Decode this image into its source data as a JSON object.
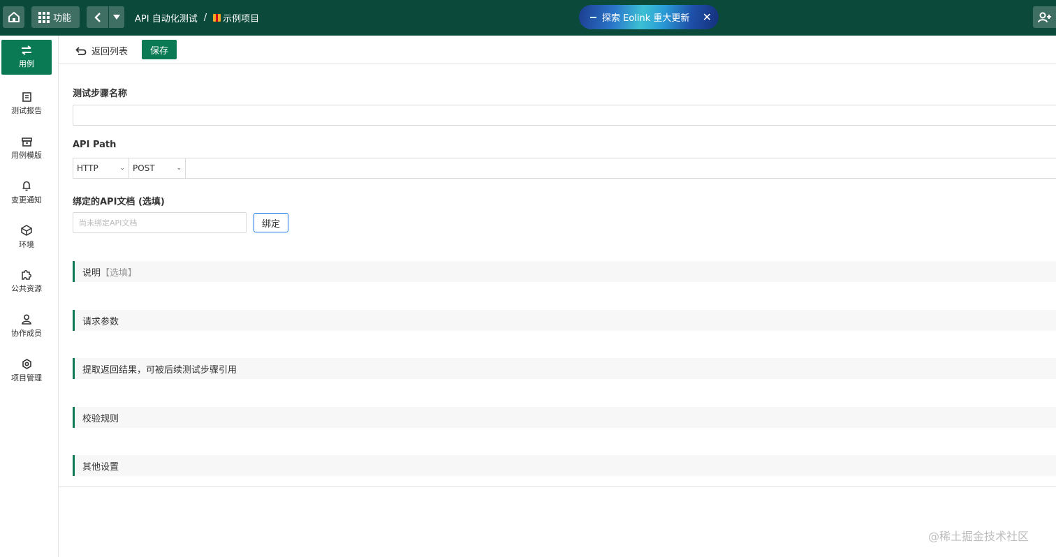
{
  "topbar": {
    "func_label": "功能",
    "breadcrumb": {
      "module": "API 自动化测试",
      "separator": "/",
      "project": "示例项目"
    },
    "promo": {
      "text": "探索 Eolink 重大更新",
      "close": "✕"
    }
  },
  "sidebar": {
    "items": [
      {
        "label": "用例",
        "icon": "swap-arrows-icon",
        "active": true
      },
      {
        "label": "测试报告",
        "icon": "report-icon"
      },
      {
        "label": "用例模版",
        "icon": "template-box-icon"
      },
      {
        "label": "变更通知",
        "icon": "bell-icon"
      },
      {
        "label": "环境",
        "icon": "cube-icon"
      },
      {
        "label": "公共资源",
        "icon": "puzzle-icon"
      },
      {
        "label": "协作成员",
        "icon": "member-icon"
      },
      {
        "label": "项目管理",
        "icon": "gear-icon"
      }
    ]
  },
  "toolbar": {
    "back_label": "返回列表",
    "save_label": "保存"
  },
  "form": {
    "step_name_label": "测试步骤名称",
    "step_name_value": "",
    "api_path_label": "API Path",
    "protocol": "HTTP",
    "method": "POST",
    "path_value": "",
    "bind_doc_label": "绑定的API文档 (选填)",
    "bind_doc_placeholder": "尚未绑定API文档",
    "bind_button": "绑定"
  },
  "sections": {
    "description": "说明",
    "description_optional": "【选填】",
    "request_params": "请求参数",
    "extract_results": "提取返回结果，可被后续测试步骤引用",
    "validation_rules": "校验规则",
    "other_settings": "其他设置"
  },
  "watermark": "@稀土掘金技术社区",
  "colors": {
    "topbar": "#0b4a3a",
    "accent": "#0a7a55",
    "bind_border": "#1a73e8"
  }
}
